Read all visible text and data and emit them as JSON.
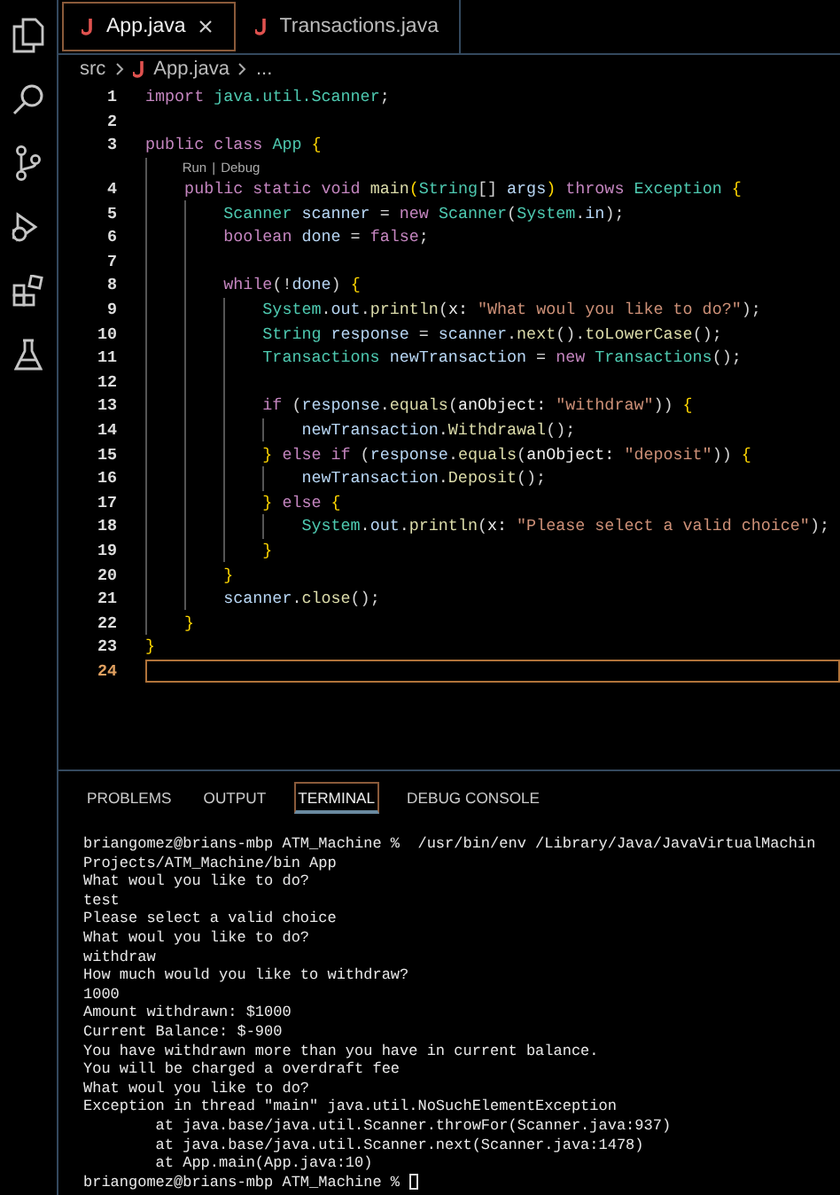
{
  "activity_bar": {
    "items": [
      {
        "kind": "files",
        "selected": false
      },
      {
        "kind": "search",
        "selected": false
      },
      {
        "kind": "source-control",
        "selected": false
      },
      {
        "kind": "run-debug",
        "selected": false
      },
      {
        "kind": "extensions",
        "selected": false
      },
      {
        "kind": "testing",
        "selected": false
      }
    ]
  },
  "tabs": [
    {
      "label": "App.java",
      "selected": true,
      "closable": true
    },
    {
      "label": "Transactions.java",
      "selected": false,
      "closable": false
    }
  ],
  "breadcrumb": [
    {
      "label": "src",
      "java": false
    },
    {
      "label": "App.java",
      "java": true
    },
    {
      "label": "...",
      "java": false
    }
  ],
  "editor": {
    "lines": [
      {
        "kind": "code",
        "number": "1",
        "current": false,
        "tokens": [
          {
            "t": "import ",
            "kind": "kw"
          },
          {
            "t": "java.util.Scanner",
            "kind": "type"
          },
          {
            "t": ";",
            "kind": "p"
          }
        ]
      },
      {
        "kind": "code",
        "number": "2",
        "current": false
      },
      {
        "kind": "code",
        "number": "3",
        "current": false,
        "tokens": [
          {
            "t": "public class ",
            "kind": "kw"
          },
          {
            "t": "App ",
            "kind": "type"
          },
          {
            "t": "{",
            "kind": "b"
          }
        ]
      },
      {
        "kind": "codelens",
        "actions": [
          "Run",
          "Debug"
        ],
        "separator": "|"
      },
      {
        "kind": "code",
        "number": "4",
        "current": false,
        "tokens": [
          {
            "t": "    public static void ",
            "kind": "kw"
          },
          {
            "t": "main",
            "kind": "fn"
          },
          {
            "t": "(",
            "kind": "b"
          },
          {
            "t": "String",
            "kind": "type"
          },
          {
            "t": "[] ",
            "kind": "p"
          },
          {
            "t": "args",
            "kind": "var"
          },
          {
            "t": ")",
            "kind": "b"
          },
          {
            "t": " throws ",
            "kind": "kw"
          },
          {
            "t": "Exception ",
            "kind": "type"
          },
          {
            "t": "{",
            "kind": "b"
          }
        ]
      },
      {
        "kind": "code",
        "number": "5",
        "current": false,
        "tokens": [
          {
            "t": "        Scanner ",
            "kind": "type"
          },
          {
            "t": "scanner",
            "kind": "var"
          },
          {
            "t": " = ",
            "kind": "p"
          },
          {
            "t": "new ",
            "kind": "kw"
          },
          {
            "t": "Scanner",
            "kind": "type"
          },
          {
            "t": "(",
            "kind": "p"
          },
          {
            "t": "System",
            "kind": "type"
          },
          {
            "t": ".",
            "kind": "p"
          },
          {
            "t": "in",
            "kind": "var"
          },
          {
            "t": ");",
            "kind": "p"
          }
        ]
      },
      {
        "kind": "code",
        "number": "6",
        "current": false,
        "tokens": [
          {
            "t": "        boolean ",
            "kind": "kw"
          },
          {
            "t": "done",
            "kind": "var"
          },
          {
            "t": " = ",
            "kind": "p"
          },
          {
            "t": "false",
            "kind": "kw"
          },
          {
            "t": ";",
            "kind": "p"
          }
        ]
      },
      {
        "kind": "code",
        "number": "7",
        "current": false
      },
      {
        "kind": "code",
        "number": "8",
        "current": false,
        "tokens": [
          {
            "t": "        while",
            "kind": "kw"
          },
          {
            "t": "(!",
            "kind": "p"
          },
          {
            "t": "done",
            "kind": "var"
          },
          {
            "t": ") ",
            "kind": "p"
          },
          {
            "t": "{",
            "kind": "b"
          }
        ]
      },
      {
        "kind": "code",
        "number": "9",
        "current": false,
        "tokens": [
          {
            "t": "            System",
            "kind": "type"
          },
          {
            "t": ".",
            "kind": "p"
          },
          {
            "t": "out",
            "kind": "var"
          },
          {
            "t": ".",
            "kind": "p"
          },
          {
            "t": "println",
            "kind": "fn"
          },
          {
            "t": "(",
            "kind": "p"
          },
          {
            "t": "x: ",
            "kind": "hint"
          },
          {
            "t": "\"What woul you like to do?\"",
            "kind": "str"
          },
          {
            "t": ");",
            "kind": "p"
          }
        ]
      },
      {
        "kind": "code",
        "number": "10",
        "current": false,
        "tokens": [
          {
            "t": "            String ",
            "kind": "type"
          },
          {
            "t": "response",
            "kind": "var"
          },
          {
            "t": " = ",
            "kind": "p"
          },
          {
            "t": "scanner",
            "kind": "var"
          },
          {
            "t": ".",
            "kind": "p"
          },
          {
            "t": "next",
            "kind": "fn"
          },
          {
            "t": "().",
            "kind": "p"
          },
          {
            "t": "toLowerCase",
            "kind": "fn"
          },
          {
            "t": "();",
            "kind": "p"
          }
        ]
      },
      {
        "kind": "code",
        "number": "11",
        "current": false,
        "tokens": [
          {
            "t": "            Transactions ",
            "kind": "type"
          },
          {
            "t": "newTransaction",
            "kind": "var"
          },
          {
            "t": " = ",
            "kind": "p"
          },
          {
            "t": "new ",
            "kind": "kw"
          },
          {
            "t": "Transactions",
            "kind": "type"
          },
          {
            "t": "();",
            "kind": "p"
          }
        ]
      },
      {
        "kind": "code",
        "number": "12",
        "current": false
      },
      {
        "kind": "code",
        "number": "13",
        "current": false,
        "tokens": [
          {
            "t": "            if",
            "kind": "kw"
          },
          {
            "t": " (",
            "kind": "p"
          },
          {
            "t": "response",
            "kind": "var"
          },
          {
            "t": ".",
            "kind": "p"
          },
          {
            "t": "equals",
            "kind": "fn"
          },
          {
            "t": "(",
            "kind": "p"
          },
          {
            "t": "anObject: ",
            "kind": "hint"
          },
          {
            "t": "\"withdraw\"",
            "kind": "str"
          },
          {
            "t": ")) ",
            "kind": "p"
          },
          {
            "t": "{",
            "kind": "b"
          }
        ]
      },
      {
        "kind": "code",
        "number": "14",
        "current": false,
        "tokens": [
          {
            "t": "                newTransaction",
            "kind": "var"
          },
          {
            "t": ".",
            "kind": "p"
          },
          {
            "t": "Withdrawal",
            "kind": "fn"
          },
          {
            "t": "();",
            "kind": "p"
          }
        ]
      },
      {
        "kind": "code",
        "number": "15",
        "current": false,
        "tokens": [
          {
            "t": "            }",
            "kind": "b"
          },
          {
            "t": " else if",
            "kind": "kw"
          },
          {
            "t": " (",
            "kind": "p"
          },
          {
            "t": "response",
            "kind": "var"
          },
          {
            "t": ".",
            "kind": "p"
          },
          {
            "t": "equals",
            "kind": "fn"
          },
          {
            "t": "(",
            "kind": "p"
          },
          {
            "t": "anObject: ",
            "kind": "hint"
          },
          {
            "t": "\"deposit\"",
            "kind": "str"
          },
          {
            "t": ")) ",
            "kind": "p"
          },
          {
            "t": "{",
            "kind": "b"
          }
        ]
      },
      {
        "kind": "code",
        "number": "16",
        "current": false,
        "tokens": [
          {
            "t": "                newTransaction",
            "kind": "var"
          },
          {
            "t": ".",
            "kind": "p"
          },
          {
            "t": "Deposit",
            "kind": "fn"
          },
          {
            "t": "();",
            "kind": "p"
          }
        ]
      },
      {
        "kind": "code",
        "number": "17",
        "current": false,
        "tokens": [
          {
            "t": "            }",
            "kind": "b"
          },
          {
            "t": " else ",
            "kind": "kw"
          },
          {
            "t": "{",
            "kind": "b"
          }
        ]
      },
      {
        "kind": "code",
        "number": "18",
        "current": false,
        "tokens": [
          {
            "t": "                System",
            "kind": "type"
          },
          {
            "t": ".",
            "kind": "p"
          },
          {
            "t": "out",
            "kind": "var"
          },
          {
            "t": ".",
            "kind": "p"
          },
          {
            "t": "println",
            "kind": "fn"
          },
          {
            "t": "(",
            "kind": "p"
          },
          {
            "t": "x: ",
            "kind": "hint"
          },
          {
            "t": "\"Please select a valid choice\"",
            "kind": "str"
          },
          {
            "t": ");",
            "kind": "p"
          }
        ]
      },
      {
        "kind": "code",
        "number": "19",
        "current": false,
        "tokens": [
          {
            "t": "            }",
            "kind": "b"
          }
        ]
      },
      {
        "kind": "code",
        "number": "20",
        "current": false,
        "tokens": [
          {
            "t": "        }",
            "kind": "b"
          }
        ]
      },
      {
        "kind": "code",
        "number": "21",
        "current": false,
        "tokens": [
          {
            "t": "        scanner",
            "kind": "var"
          },
          {
            "t": ".",
            "kind": "p"
          },
          {
            "t": "close",
            "kind": "fn"
          },
          {
            "t": "();",
            "kind": "p"
          }
        ]
      },
      {
        "kind": "code",
        "number": "22",
        "current": false,
        "tokens": [
          {
            "t": "    }",
            "kind": "b"
          }
        ]
      },
      {
        "kind": "code",
        "number": "23",
        "current": false,
        "tokens": [
          {
            "t": "}",
            "kind": "b"
          }
        ]
      },
      {
        "kind": "code",
        "number": "24",
        "current": true
      }
    ]
  },
  "panel": {
    "tabs": [
      {
        "label": "PROBLEMS",
        "selected": false
      },
      {
        "label": "OUTPUT",
        "selected": false
      },
      {
        "label": "TERMINAL",
        "selected": true
      },
      {
        "label": "DEBUG CONSOLE",
        "selected": false
      }
    ],
    "terminal": {
      "cursor": true,
      "lines": [
        "briangomez@brians-mbp ATM_Machine %  /usr/bin/env /Library/Java/JavaVirtualMachin",
        "Projects/ATM_Machine/bin App",
        "What woul you like to do?",
        "test",
        "Please select a valid choice",
        "What woul you like to do?",
        "withdraw",
        "How much would you like to withdraw?",
        "1000",
        "Amount withdrawn: $1000",
        "Current Balance: $-900",
        "You have withdrawn more than you have in current balance.",
        "You will be charged a overdraft fee",
        "What woul you like to do?",
        "Exception in thread \"main\" java.util.NoSuchElementException",
        "        at java.base/java.util.Scanner.throwFor(Scanner.java:937)",
        "        at java.base/java.util.Scanner.next(Scanner.java:1478)",
        "        at App.main(App.java:10)",
        "briangomez@brians-mbp ATM_Machine %"
      ]
    }
  }
}
